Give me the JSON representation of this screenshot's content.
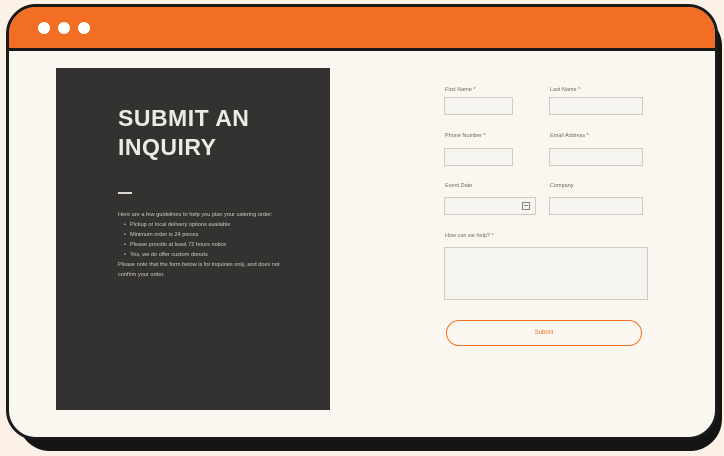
{
  "window": {
    "title_dots": 3,
    "accent": "#f26e24"
  },
  "panel": {
    "title": "SUBMIT AN\nINQUIRY",
    "intro": "Here are a few guidelines to help you plan your catering order:",
    "bullets": [
      "Pickup or local delivery options available",
      "Minimum order is 24 pieces",
      "Please provide at least 72 hours notice",
      "Yes, we do offer custom donuts"
    ],
    "footer": "Please note that the form below is for inquiries only, and does not confirm your order."
  },
  "form": {
    "first_name_label": "First Name *",
    "last_name_label": "Last Name *",
    "phone_label": "Phone Number *",
    "email_label": "Email Address *",
    "event_date_label": "Event Date",
    "company_label": "Company",
    "message_label": "How can we help? *",
    "submit_label": "Submit"
  }
}
